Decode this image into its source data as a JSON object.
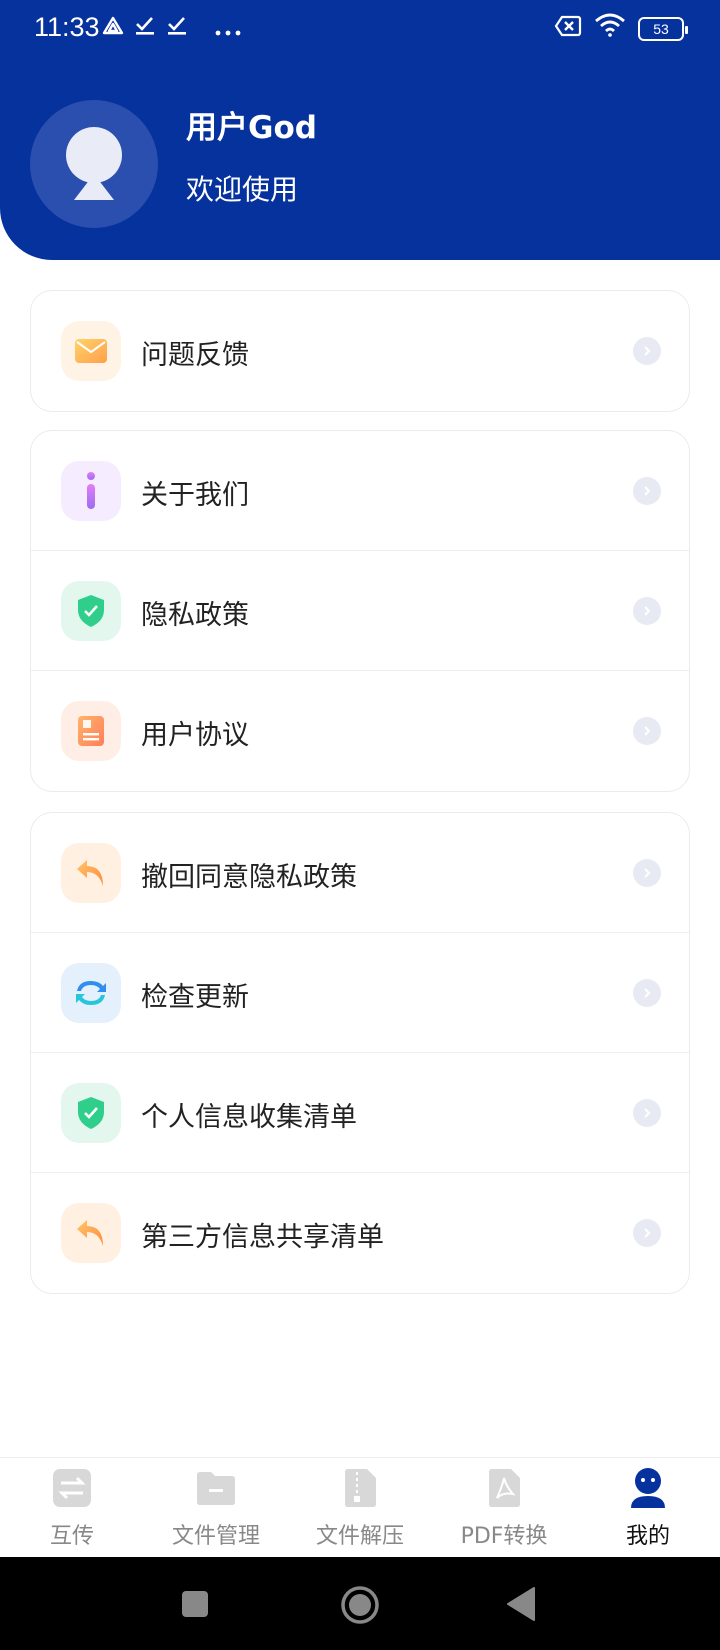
{
  "status_bar": {
    "time": "11:33",
    "battery": "53",
    "icons": [
      "drive-icon",
      "check-icon",
      "check-icon",
      "more-icon",
      "no-sim-icon",
      "wifi-icon",
      "battery-icon"
    ]
  },
  "profile": {
    "name": "用户God",
    "subtitle": "欢迎使用"
  },
  "menu": {
    "group1": [
      {
        "label": "问题反馈",
        "icon": "mail-icon"
      }
    ],
    "group2": [
      {
        "label": "关于我们",
        "icon": "info-icon"
      },
      {
        "label": "隐私政策",
        "icon": "shield-check-icon"
      },
      {
        "label": "用户协议",
        "icon": "document-icon"
      }
    ],
    "group3": [
      {
        "label": "撤回同意隐私政策",
        "icon": "undo-icon"
      },
      {
        "label": "检查更新",
        "icon": "refresh-icon"
      },
      {
        "label": "个人信息收集清单",
        "icon": "shield-check-icon"
      },
      {
        "label": "第三方信息共享清单",
        "icon": "undo-icon"
      }
    ]
  },
  "tabs": [
    {
      "label": "互传",
      "icon": "transfer-icon",
      "active": false
    },
    {
      "label": "文件管理",
      "icon": "folder-icon",
      "active": false
    },
    {
      "label": "文件解压",
      "icon": "zip-icon",
      "active": false
    },
    {
      "label": "PDF转换",
      "icon": "pdf-icon",
      "active": false
    },
    {
      "label": "我的",
      "icon": "profile-icon",
      "active": true
    }
  ],
  "colors": {
    "header_bg": "#06329d",
    "active_tab": "#06329d",
    "inactive_tab_icon": "#d8d8d8"
  }
}
